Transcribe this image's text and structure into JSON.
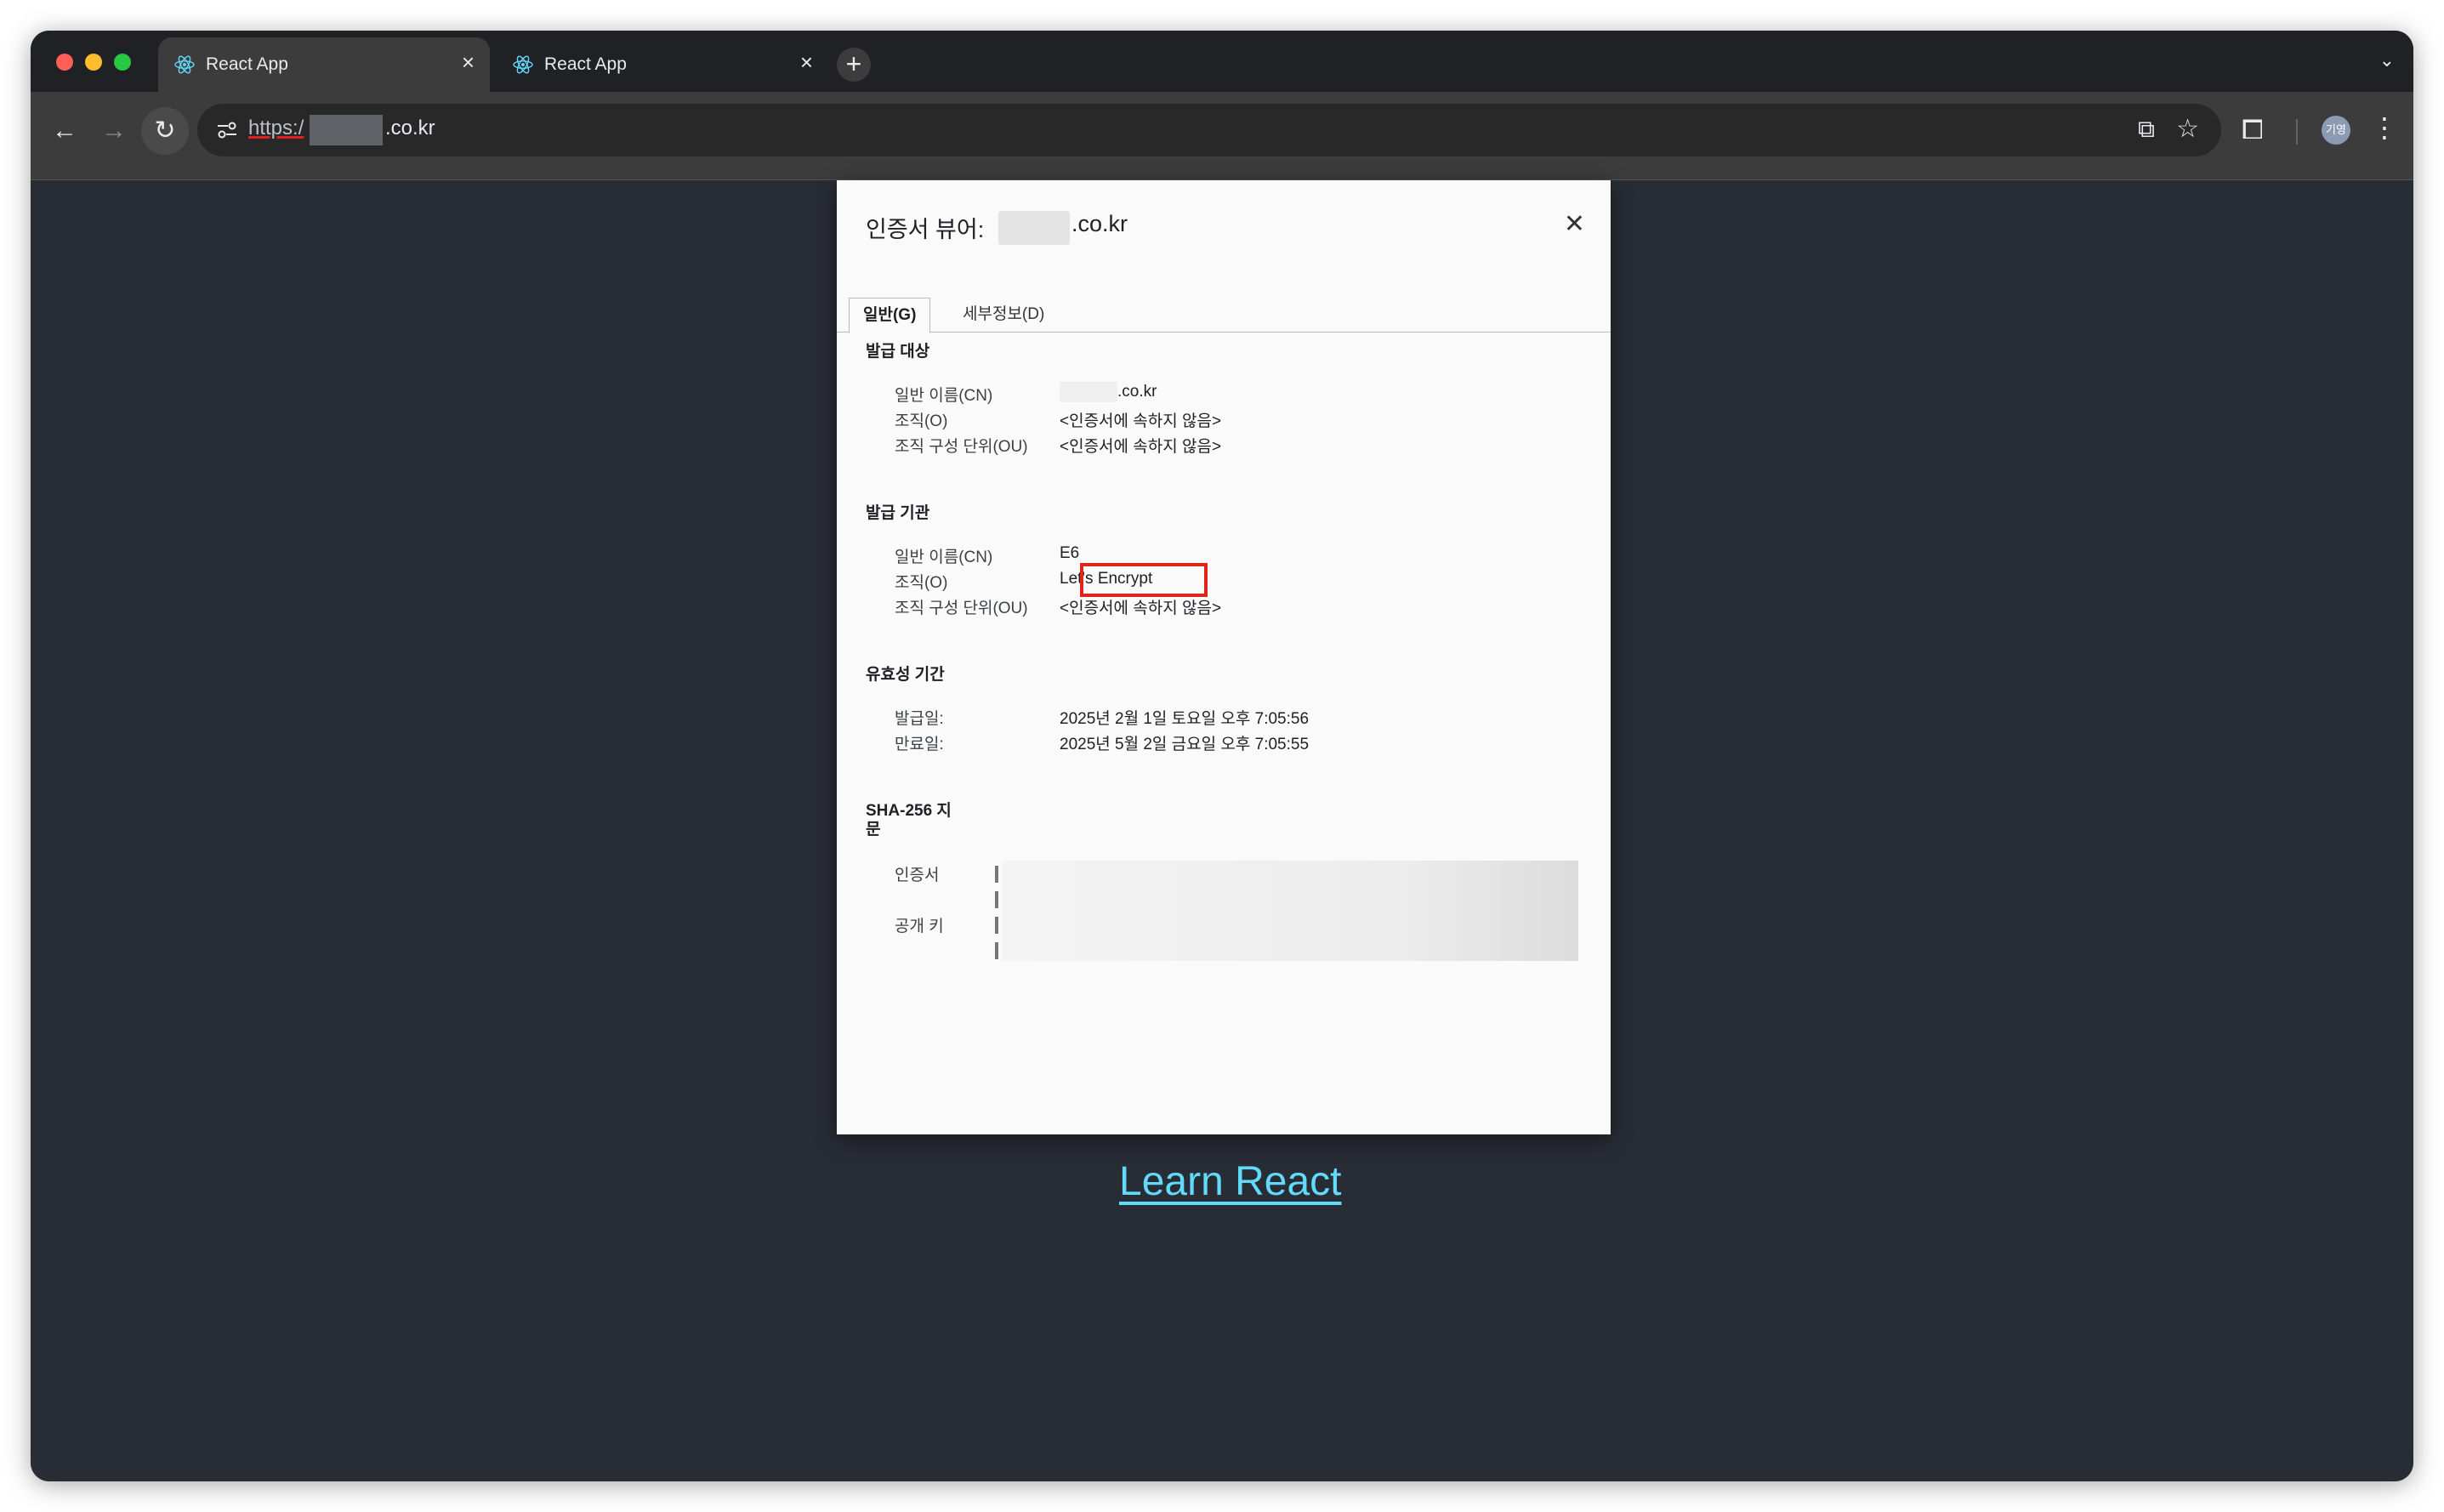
{
  "browser": {
    "tabs": [
      {
        "title": "React App",
        "active": true
      },
      {
        "title": "React App",
        "active": false
      }
    ],
    "new_tab_label": "+",
    "url": {
      "scheme": "https:/",
      "domain": ".co.kr"
    },
    "avatar_label": "기영"
  },
  "page": {
    "link_text": "Learn React",
    "background_color": "#282c34",
    "link_color": "#61dafb"
  },
  "dialog": {
    "title_prefix": "인증서 뷰어:",
    "title_domain": ".co.kr",
    "tabs": [
      {
        "label": "일반(G)",
        "active": true
      },
      {
        "label": "세부정보(D)",
        "active": false
      }
    ],
    "issued_to": {
      "heading": "발급 대상",
      "rows": [
        {
          "label": "일반 이름(CN)",
          "value": ".co.kr"
        },
        {
          "label": "조직(O)",
          "value": "<인증서에 속하지 않음>"
        },
        {
          "label": "조직 구성 단위(OU)",
          "value": "<인증서에 속하지 않음>"
        }
      ]
    },
    "issued_by": {
      "heading": "발급 기관",
      "rows": [
        {
          "label": "일반 이름(CN)",
          "value": "E6"
        },
        {
          "label": "조직(O)",
          "value": "Let's Encrypt"
        },
        {
          "label": "조직 구성 단위(OU)",
          "value": "<인증서에 속하지 않음>"
        }
      ]
    },
    "validity": {
      "heading": "유효성 기간",
      "rows": [
        {
          "label": "발급일:",
          "value": "2025년 2월 1일 토요일 오후 7:05:56"
        },
        {
          "label": "만료일:",
          "value": "2025년 5월 2일 금요일 오후 7:05:55"
        }
      ]
    },
    "fingerprints": {
      "heading_line1": "SHA-256 지",
      "heading_line2": "문",
      "rows": [
        {
          "label": "인증서"
        },
        {
          "label": "공개 키"
        }
      ]
    },
    "highlight_color": "#e0261b"
  }
}
